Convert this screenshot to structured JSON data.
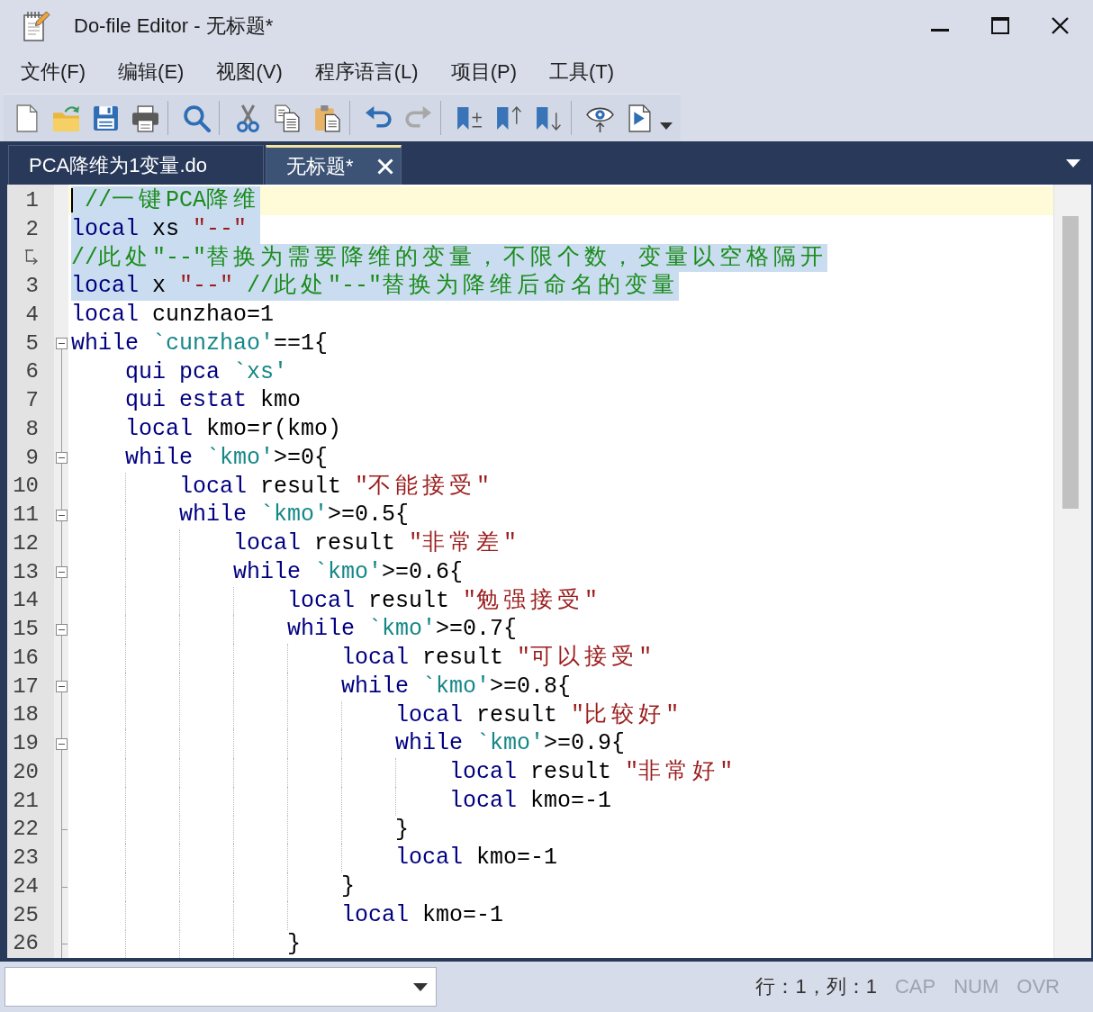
{
  "window": {
    "title": "Do-file Editor - 无标题*"
  },
  "menu": [
    "文件(F)",
    "编辑(E)",
    "视图(V)",
    "程序语言(L)",
    "项目(P)",
    "工具(T)"
  ],
  "toolbar": [
    [
      {
        "kind": "new",
        "disabled": false
      },
      {
        "kind": "open",
        "disabled": false
      },
      {
        "kind": "save",
        "disabled": false
      },
      {
        "kind": "print",
        "disabled": false
      }
    ],
    [
      {
        "kind": "find",
        "disabled": false
      }
    ],
    [
      {
        "kind": "cut",
        "disabled": false
      },
      {
        "kind": "copy",
        "disabled": false
      },
      {
        "kind": "paste",
        "disabled": false
      }
    ],
    [
      {
        "kind": "undo",
        "disabled": false
      },
      {
        "kind": "redo",
        "disabled": true
      }
    ],
    [
      {
        "kind": "bookmark",
        "disabled": false
      },
      {
        "kind": "previous",
        "disabled": false
      },
      {
        "kind": "next",
        "disabled": false
      }
    ],
    [
      {
        "kind": "show",
        "disabled": false
      },
      {
        "kind": "execute",
        "disabled": false
      },
      {
        "kind": "dropdown",
        "disabled": false
      }
    ]
  ],
  "tabs": [
    {
      "label": "PCA降维为1变量.do",
      "selected": false
    },
    {
      "label": "无标题*",
      "selected": true
    }
  ],
  "editor": {
    "rows": [
      {
        "kind": "line",
        "number": "1",
        "current": true,
        "selected": true,
        "tokens": [
          {
            "kind": "comment",
            "text": " //一键PCA降维"
          }
        ]
      },
      {
        "kind": "line",
        "number": "2",
        "current": false,
        "selected": true,
        "tokens": [
          {
            "kind": "keyword",
            "text": "local"
          },
          {
            "kind": "plain",
            "text": " xs "
          },
          {
            "kind": "string",
            "text": "\"--\" "
          }
        ]
      },
      {
        "kind": "wrap",
        "current": false,
        "selected": true,
        "tokens": [
          {
            "kind": "comment",
            "text": "//此处\"--\"替换为需要降维的变量，不限个数，变量以空格隔开"
          }
        ]
      },
      {
        "kind": "line",
        "number": "3",
        "current": false,
        "selected": true,
        "tokens": [
          {
            "kind": "keyword",
            "text": "local"
          },
          {
            "kind": "plain",
            "text": " x "
          },
          {
            "kind": "string",
            "text": "\"--\""
          },
          {
            "kind": "comment",
            "text": " //此处\"--\"替换为降维后命名的变量"
          }
        ]
      },
      {
        "kind": "line",
        "number": "4",
        "current": false,
        "selected": false,
        "tokens": [
          {
            "kind": "keyword",
            "text": "local"
          },
          {
            "kind": "plain",
            "text": " cunzhao=1"
          }
        ]
      },
      {
        "kind": "line",
        "number": "5",
        "current": false,
        "selected": false,
        "fold": {
          "kind": "start",
          "expanded": true
        },
        "tokens": [
          {
            "kind": "keyword",
            "text": "while "
          },
          {
            "kind": "macro",
            "text": "`cunzhao'"
          },
          {
            "kind": "plain",
            "text": "==1{"
          }
        ]
      },
      {
        "kind": "line",
        "number": "6",
        "current": false,
        "selected": false,
        "tokens": [
          {
            "kind": "keyword",
            "text": "    qui pca "
          },
          {
            "kind": "macro",
            "text": "`xs'"
          }
        ]
      },
      {
        "kind": "line",
        "number": "7",
        "current": false,
        "selected": false,
        "tokens": [
          {
            "kind": "keyword",
            "text": "    qui estat"
          },
          {
            "kind": "plain",
            "text": " kmo"
          }
        ]
      },
      {
        "kind": "line",
        "number": "8",
        "current": false,
        "selected": false,
        "tokens": [
          {
            "kind": "keyword",
            "text": "    local"
          },
          {
            "kind": "plain",
            "text": " kmo=r(kmo)"
          }
        ]
      },
      {
        "kind": "line",
        "number": "9",
        "current": false,
        "selected": false,
        "fold": {
          "kind": "start",
          "expanded": true
        },
        "tokens": [
          {
            "kind": "keyword",
            "text": "    while "
          },
          {
            "kind": "macro",
            "text": "`kmo'"
          },
          {
            "kind": "plain",
            "text": ">=0{"
          }
        ]
      },
      {
        "kind": "line",
        "number": "10",
        "current": false,
        "selected": false,
        "tokens": [
          {
            "kind": "keyword",
            "text": "        local"
          },
          {
            "kind": "plain",
            "text": " result "
          },
          {
            "kind": "string",
            "text": "\"不能接受\""
          }
        ]
      },
      {
        "kind": "line",
        "number": "11",
        "current": false,
        "selected": false,
        "fold": {
          "kind": "start",
          "expanded": true
        },
        "tokens": [
          {
            "kind": "keyword",
            "text": "        while "
          },
          {
            "kind": "macro",
            "text": "`kmo'"
          },
          {
            "kind": "plain",
            "text": ">=0.5{"
          }
        ]
      },
      {
        "kind": "line",
        "number": "12",
        "current": false,
        "selected": false,
        "tokens": [
          {
            "kind": "keyword",
            "text": "            local"
          },
          {
            "kind": "plain",
            "text": " result "
          },
          {
            "kind": "string",
            "text": "\"非常差\""
          }
        ]
      },
      {
        "kind": "line",
        "number": "13",
        "current": false,
        "selected": false,
        "fold": {
          "kind": "start",
          "expanded": true
        },
        "tokens": [
          {
            "kind": "keyword",
            "text": "            while "
          },
          {
            "kind": "macro",
            "text": "`kmo'"
          },
          {
            "kind": "plain",
            "text": ">=0.6{"
          }
        ]
      },
      {
        "kind": "line",
        "number": "14",
        "current": false,
        "selected": false,
        "tokens": [
          {
            "kind": "keyword",
            "text": "                local"
          },
          {
            "kind": "plain",
            "text": " result "
          },
          {
            "kind": "string",
            "text": "\"勉强接受\""
          }
        ]
      },
      {
        "kind": "line",
        "number": "15",
        "current": false,
        "selected": false,
        "fold": {
          "kind": "start",
          "expanded": true
        },
        "tokens": [
          {
            "kind": "keyword",
            "text": "                while "
          },
          {
            "kind": "macro",
            "text": "`kmo'"
          },
          {
            "kind": "plain",
            "text": ">=0.7{"
          }
        ]
      },
      {
        "kind": "line",
        "number": "16",
        "current": false,
        "selected": false,
        "tokens": [
          {
            "kind": "keyword",
            "text": "                    local"
          },
          {
            "kind": "plain",
            "text": " result "
          },
          {
            "kind": "string",
            "text": "\"可以接受\""
          }
        ]
      },
      {
        "kind": "line",
        "number": "17",
        "current": false,
        "selected": false,
        "fold": {
          "kind": "start",
          "expanded": true
        },
        "tokens": [
          {
            "kind": "keyword",
            "text": "                    while "
          },
          {
            "kind": "macro",
            "text": "`kmo'"
          },
          {
            "kind": "plain",
            "text": ">=0.8{"
          }
        ]
      },
      {
        "kind": "line",
        "number": "18",
        "current": false,
        "selected": false,
        "tokens": [
          {
            "kind": "keyword",
            "text": "                        local"
          },
          {
            "kind": "plain",
            "text": " result "
          },
          {
            "kind": "string",
            "text": "\"比较好\""
          }
        ]
      },
      {
        "kind": "line",
        "number": "19",
        "current": false,
        "selected": false,
        "fold": {
          "kind": "start",
          "expanded": true
        },
        "tokens": [
          {
            "kind": "keyword",
            "text": "                        while "
          },
          {
            "kind": "macro",
            "text": "`kmo'"
          },
          {
            "kind": "plain",
            "text": ">=0.9{"
          }
        ]
      },
      {
        "kind": "line",
        "number": "20",
        "current": false,
        "selected": false,
        "tokens": [
          {
            "kind": "keyword",
            "text": "                            local"
          },
          {
            "kind": "plain",
            "text": " result "
          },
          {
            "kind": "string",
            "text": "\"非常好\""
          }
        ]
      },
      {
        "kind": "line",
        "number": "21",
        "current": false,
        "selected": false,
        "tokens": [
          {
            "kind": "keyword",
            "text": "                            local"
          },
          {
            "kind": "plain",
            "text": " kmo=-1"
          }
        ]
      },
      {
        "kind": "line",
        "number": "22",
        "current": false,
        "selected": false,
        "fold": {
          "kind": "end"
        },
        "tokens": [
          {
            "kind": "plain",
            "text": "                        }"
          }
        ]
      },
      {
        "kind": "line",
        "number": "23",
        "current": false,
        "selected": false,
        "tokens": [
          {
            "kind": "keyword",
            "text": "                        local"
          },
          {
            "kind": "plain",
            "text": " kmo=-1"
          }
        ]
      },
      {
        "kind": "line",
        "number": "24",
        "current": false,
        "selected": false,
        "fold": {
          "kind": "end"
        },
        "tokens": [
          {
            "kind": "plain",
            "text": "                    }"
          }
        ]
      },
      {
        "kind": "line",
        "number": "25",
        "current": false,
        "selected": false,
        "tokens": [
          {
            "kind": "keyword",
            "text": "                    local"
          },
          {
            "kind": "plain",
            "text": " kmo=-1"
          }
        ]
      },
      {
        "kind": "line",
        "number": "26",
        "current": false,
        "selected": false,
        "fold": {
          "kind": "end"
        },
        "tokens": [
          {
            "kind": "plain",
            "text": "                }"
          }
        ]
      }
    ]
  },
  "status_bar": {
    "position": "行：1，列：1",
    "indicators": [
      {
        "label": "CAP",
        "on": false
      },
      {
        "label": "NUM",
        "on": false
      },
      {
        "label": "OVR",
        "on": false
      }
    ]
  }
}
